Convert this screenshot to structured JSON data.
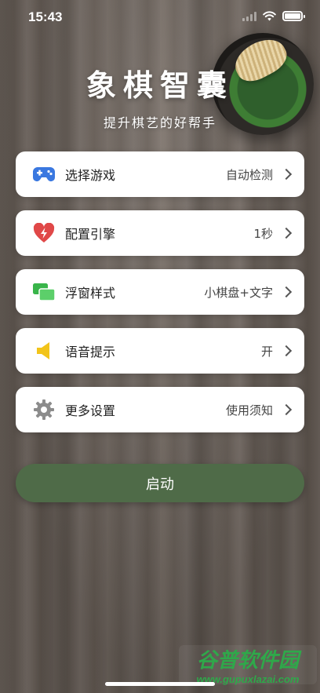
{
  "status_bar": {
    "time": "15:43"
  },
  "header": {
    "title": "象棋智囊",
    "subtitle": "提升棋艺的好帮手"
  },
  "menu": {
    "items": [
      {
        "label": "选择游戏",
        "value": "自动检测",
        "icon": "gamepad-icon",
        "icon_color": "#3a78e0"
      },
      {
        "label": "配置引擎",
        "value": "1秒",
        "icon": "heart-bolt-icon",
        "icon_color": "#e04848"
      },
      {
        "label": "浮窗样式",
        "value": "小棋盘+文字",
        "icon": "windows-icon",
        "icon_color": "#39b54a"
      },
      {
        "label": "语音提示",
        "value": "开",
        "icon": "speaker-icon",
        "icon_color": "#f2c41a"
      },
      {
        "label": "更多设置",
        "value": "使用须知",
        "icon": "gear-icon",
        "icon_color": "#8c8c8c"
      }
    ]
  },
  "start_button": {
    "label": "启动",
    "color": "#4f6b48"
  },
  "watermark": {
    "main": "谷普软件园",
    "url": "www.gupuxlazai.com"
  }
}
